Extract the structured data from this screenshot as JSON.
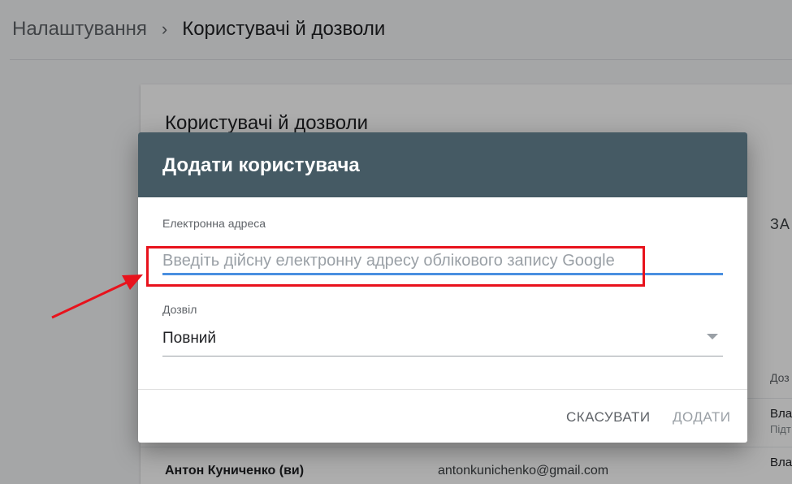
{
  "breadcrumb": {
    "parent": "Налаштування",
    "separator": "›",
    "current": "Користувачі й дозволи"
  },
  "background_card": {
    "title": "Користувачі й дозволи",
    "add_button_partial": "ЗА",
    "column_header_partial": "Доз",
    "rows": [
      {
        "permission_partial": "Вла",
        "permission_sub_partial": "Підт"
      },
      {
        "name": "Антон Куниченко (ви)",
        "email": "antonkunichenko@gmail.com",
        "permission_partial": "Вла"
      }
    ]
  },
  "dialog": {
    "title": "Додати користувача",
    "email_field": {
      "label": "Електронна адреса",
      "value": "",
      "placeholder": "Введіть дійсну електронну адресу облікового запису Google"
    },
    "permission_field": {
      "label": "Дозвіл",
      "selected": "Повний"
    },
    "cancel_label": "СКАСУВАТИ",
    "add_label": "ДОДАТИ"
  },
  "colors": {
    "dialog_header": "#455a64",
    "input_focus_underline": "#4a8fe0",
    "annotation": "#e8121c"
  }
}
